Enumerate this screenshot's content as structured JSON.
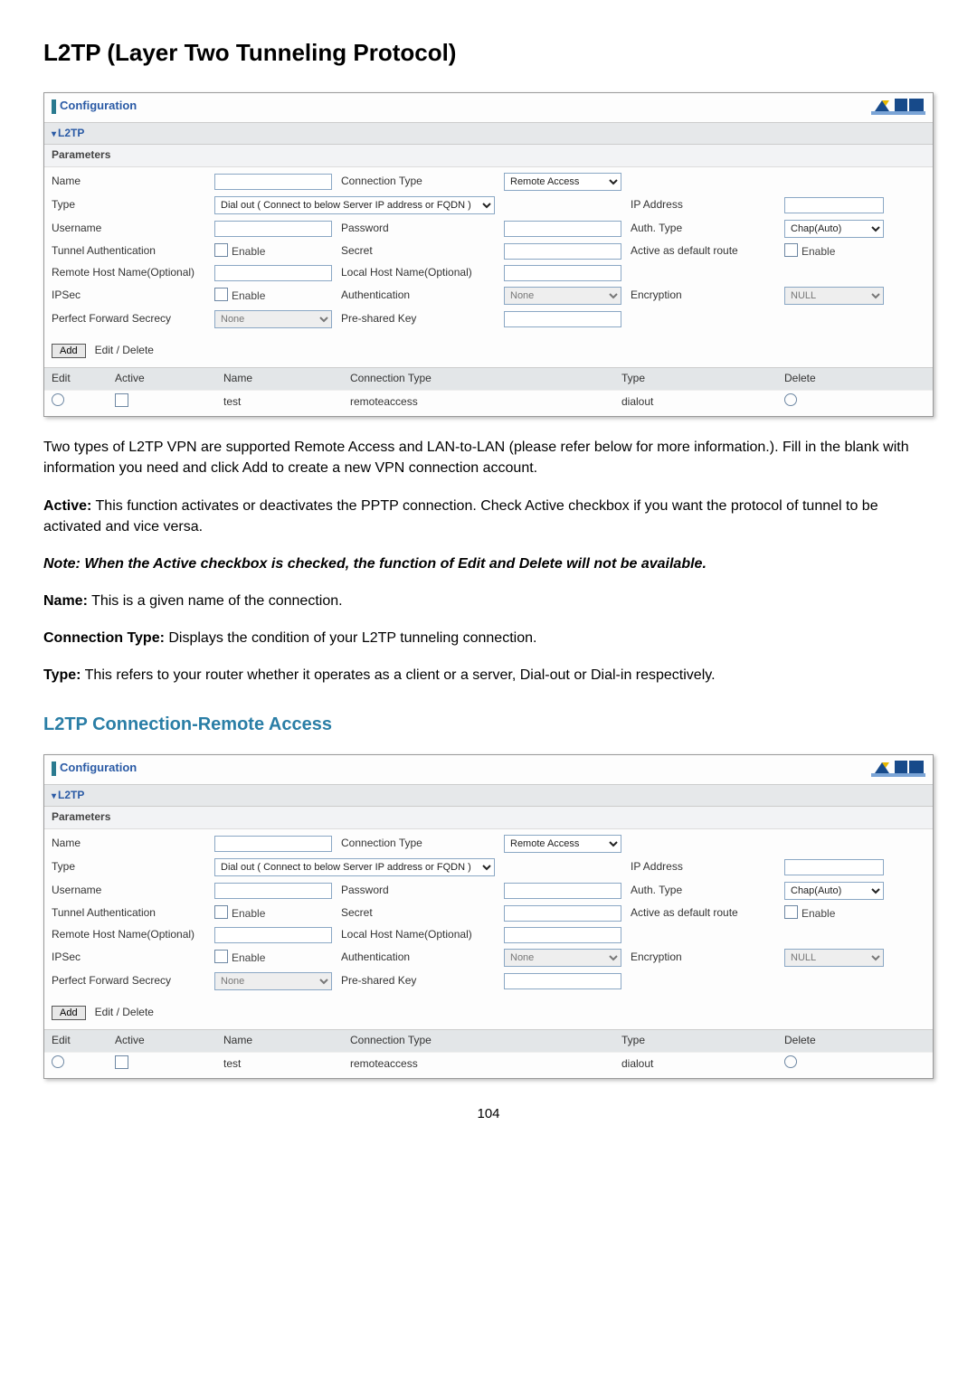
{
  "page": {
    "title": "L2TP (Layer Two Tunneling Protocol)",
    "number": "104"
  },
  "panel": {
    "header_title": "Configuration",
    "section_label": "L2TP",
    "params_label": "Parameters",
    "fields": {
      "name": "Name",
      "connection_type": "Connection Type",
      "connection_type_val": "Remote Access",
      "type": "Type",
      "type_val": "Dial out ( Connect to below Server IP address or FQDN )",
      "ip_address": "IP Address",
      "username": "Username",
      "password": "Password",
      "auth_type": "Auth. Type",
      "auth_type_val": "Chap(Auto)",
      "tunnel_auth": "Tunnel Authentication",
      "enable": "Enable",
      "secret": "Secret",
      "active_default": "Active as default route",
      "remote_host": "Remote Host Name(Optional)",
      "local_host": "Local Host Name(Optional)",
      "ipsec": "IPSec",
      "authentication": "Authentication",
      "auth_val": "None",
      "encryption": "Encryption",
      "encryption_val": "NULL",
      "pfs": "Perfect Forward Secrecy",
      "pfs_val": "None",
      "psk": "Pre-shared Key"
    },
    "actions": {
      "add": "Add",
      "edit_delete": "Edit / Delete"
    },
    "list": {
      "headers": {
        "edit": "Edit",
        "active": "Active",
        "name": "Name",
        "connection_type": "Connection Type",
        "type": "Type",
        "delete": "Delete"
      },
      "row": {
        "name": "test",
        "connection_type": "remoteaccess",
        "type": "dialout"
      }
    }
  },
  "body": {
    "p1": "Two types of L2TP VPN are supported Remote Access and LAN-to-LAN (please refer below for more information.). Fill in the blank with information you need and click Add to create a new VPN connection account.",
    "active_label": "Active:",
    "active_text": " This function activates or deactivates the PPTP connection. Check Active checkbox if you want the protocol of tunnel to be activated and vice versa.",
    "note": "Note: When the Active checkbox is checked, the function of Edit and Delete will not be available.",
    "name_label": "Name:",
    "name_text": " This is a given name of the connection.",
    "ct_label": "Connection Type:",
    "ct_text": " Displays the condition of your L2TP tunneling connection.",
    "type_label": "Type:",
    "type_text": " This refers to your router whether it operates as a client or a server, Dial-out or Dial-in respectively."
  },
  "subheading": "L2TP Connection-Remote Access"
}
